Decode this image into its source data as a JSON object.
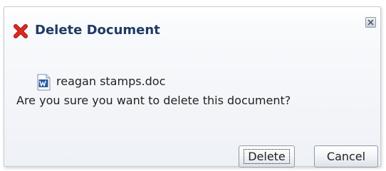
{
  "dialog": {
    "title": "Delete Document",
    "title_icon": "error-x-icon",
    "close_icon": "close-icon",
    "file": {
      "icon": "word-document-icon",
      "name": "reagan stamps.doc"
    },
    "message": "Are you sure you want to delete this document?",
    "buttons": {
      "delete_label": "Delete",
      "cancel_label": "Cancel"
    }
  },
  "colors": {
    "title": "#1f3b66",
    "error_icon": "#d9251d",
    "word_icon": "#2c5aa0"
  }
}
